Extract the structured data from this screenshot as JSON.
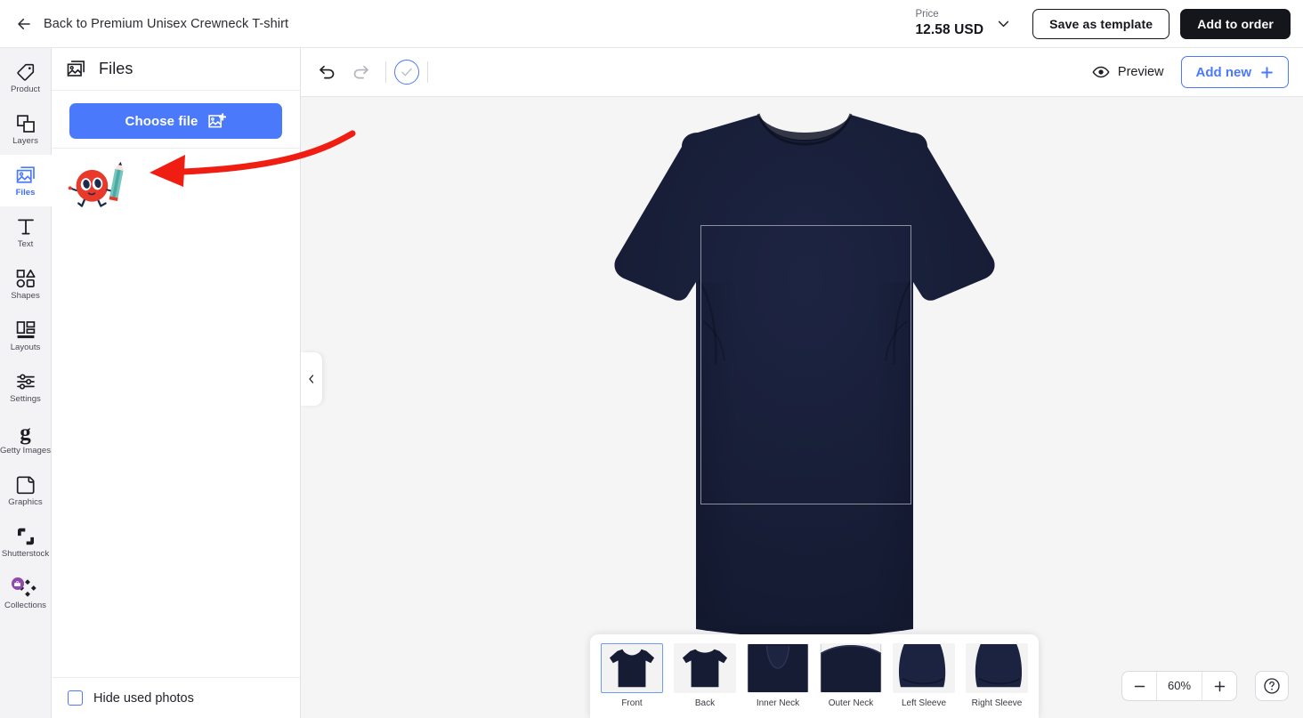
{
  "header": {
    "back_label": "Back to Premium Unisex Crewneck T-shirt",
    "back_icon": "arrow-left-icon",
    "price_label": "Price",
    "price_value": "12.58 USD",
    "price_chevron_icon": "chevron-down-icon",
    "save_template_label": "Save as template",
    "add_to_order_label": "Add to order"
  },
  "sidebar": {
    "items": [
      {
        "label": "Product",
        "icon": "tag-icon",
        "active": false
      },
      {
        "label": "Layers",
        "icon": "layers-icon",
        "active": false
      },
      {
        "label": "Files",
        "icon": "image-stack-icon",
        "active": true
      },
      {
        "label": "Text",
        "icon": "text-t-icon",
        "active": false
      },
      {
        "label": "Shapes",
        "icon": "shapes-icon",
        "active": false
      },
      {
        "label": "Layouts",
        "icon": "layouts-icon",
        "active": false
      },
      {
        "label": "Settings",
        "icon": "sliders-icon",
        "active": false
      },
      {
        "label": "Getty Images",
        "icon": "getty-g-icon",
        "active": false
      },
      {
        "label": "Graphics",
        "icon": "sticker-icon",
        "active": false
      },
      {
        "label": "Shutterstock",
        "icon": "shutterstock-icon",
        "active": false
      },
      {
        "label": "Collections",
        "icon": "collections-icon",
        "active": false
      }
    ]
  },
  "panel": {
    "title": "Files",
    "title_icon": "image-stack-icon",
    "choose_file_label": "Choose file",
    "choose_file_icon": "image-add-icon",
    "files": [
      {
        "name": "red-character-with-pencil-thumbnail"
      }
    ],
    "hide_used_photos_label": "Hide used photos",
    "hide_used_photos_checked": false,
    "collapse_icon": "chevron-left-icon"
  },
  "toolbar": {
    "undo_icon": "undo-icon",
    "redo_icon": "redo-icon",
    "approve_icon": "check-circle-icon",
    "preview_label": "Preview",
    "preview_icon": "eye-icon",
    "add_new_label": "Add new",
    "add_new_icon": "plus-icon"
  },
  "canvas": {
    "product_color": "#161c33",
    "background_color": "#f5f5f6",
    "print_area_border_color": "#8d90a0"
  },
  "thumbnails": [
    {
      "label": "Front",
      "view": "front",
      "selected": true
    },
    {
      "label": "Back",
      "view": "back",
      "selected": false
    },
    {
      "label": "Inner Neck",
      "view": "inner-neck",
      "selected": false
    },
    {
      "label": "Outer Neck",
      "view": "outer-neck",
      "selected": false
    },
    {
      "label": "Left Sleeve",
      "view": "left-sleeve",
      "selected": false
    },
    {
      "label": "Right Sleeve",
      "view": "right-sleeve",
      "selected": false
    }
  ],
  "zoom": {
    "minus_icon": "minus-icon",
    "value": "60%",
    "plus_icon": "plus-icon",
    "help_icon": "question-mark-icon"
  },
  "annotation": {
    "type": "red-curved-arrow",
    "color": "#f01e12",
    "points_to": "file-thumbnail"
  },
  "colors": {
    "accent_blue": "#4a7afb",
    "dark": "#15151c",
    "rail_bg": "#f3f3f5",
    "annotation_red": "#f01e12"
  }
}
